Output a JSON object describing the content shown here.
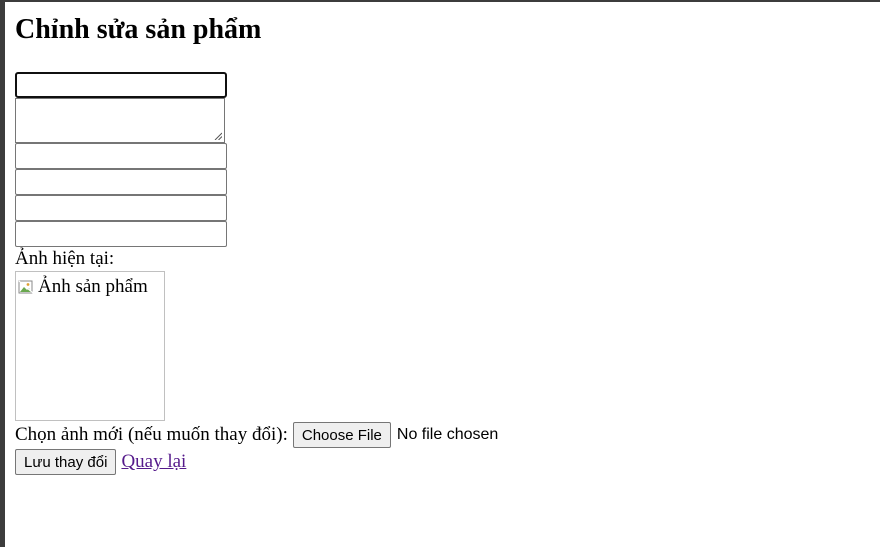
{
  "page": {
    "title": "Chỉnh sửa sản phẩm"
  },
  "form": {
    "fields": [
      {
        "name": "name",
        "value": "",
        "placeholder": ""
      },
      {
        "name": "description",
        "value": "",
        "placeholder": ""
      },
      {
        "name": "field3",
        "value": "",
        "placeholder": ""
      },
      {
        "name": "field4",
        "value": "",
        "placeholder": ""
      },
      {
        "name": "field5",
        "value": "",
        "placeholder": ""
      },
      {
        "name": "field6",
        "value": "",
        "placeholder": ""
      }
    ],
    "current_image_label": "Ảnh hiện tại:",
    "current_image_alt": "Ảnh sản phẩm",
    "new_image_label": "Chọn ảnh mới (nếu muốn thay đổi):",
    "choose_file_label": "Choose File",
    "no_file_text": "No file chosen",
    "save_label": "Lưu thay đổi",
    "back_label": "Quay lại"
  },
  "colors": {
    "link": "#551a8b",
    "button_bg": "#efefef",
    "input_border": "#767676"
  }
}
